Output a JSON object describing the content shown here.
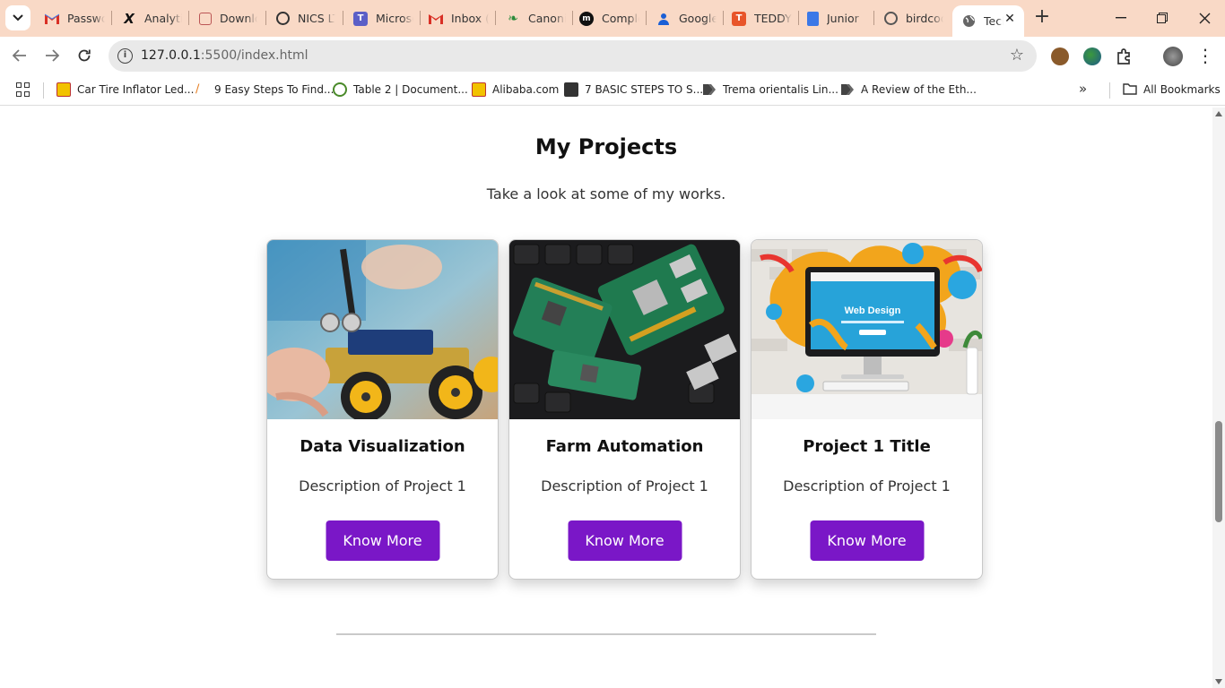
{
  "browser": {
    "tabs": [
      {
        "title": "Password",
        "icon": "gmail-icon"
      },
      {
        "title": "Analytics",
        "icon": "x-icon"
      },
      {
        "title": "Download",
        "icon": "download-icon"
      },
      {
        "title": "NICS LTD",
        "icon": "nics-icon"
      },
      {
        "title": "Microsoft",
        "icon": "teams-icon"
      },
      {
        "title": "Inbox (",
        "icon": "gmail-icon"
      },
      {
        "title": "Canonical",
        "icon": "canonical-icon"
      },
      {
        "title": "Complete",
        "icon": "medium-icon"
      },
      {
        "title": "Google",
        "icon": "google-account-icon"
      },
      {
        "title": "TEDDY",
        "icon": "teddy-icon"
      },
      {
        "title": "Junior",
        "icon": "docs-icon"
      },
      {
        "title": "birdcode",
        "icon": "github-icon"
      },
      {
        "title": "Tech",
        "icon": "globe-icon",
        "active": true
      }
    ],
    "address_bar": {
      "host": "127.0.0.1",
      "path": ":5500/index.html"
    },
    "bookmarks": [
      {
        "label": "Car Tire Inflator Led..."
      },
      {
        "label": "9 Easy Steps To Find..."
      },
      {
        "label": "Table 2 | Document..."
      },
      {
        "label": "Alibaba.com"
      },
      {
        "label": "7 BASIC STEPS TO S..."
      },
      {
        "label": "Trema orientalis Lin..."
      },
      {
        "label": "A Review of the Eth..."
      }
    ],
    "all_bookmarks_label": "All Bookmarks",
    "colors": {
      "tab_strip": "#f9d9c6",
      "accent_button": "#7a17c7"
    }
  },
  "section": {
    "title": "My Projects",
    "subtitle": "Take a look at some of my works."
  },
  "projects": [
    {
      "title": "Data Visualization",
      "description": "Description of Project 1",
      "button": "Know More",
      "image": "robot-car-image"
    },
    {
      "title": "Farm Automation",
      "description": "Description of Project 1",
      "button": "Know More",
      "image": "raspberry-pi-boards-image"
    },
    {
      "title": "Project 1 Title",
      "description": "Description of Project 1",
      "button": "Know More",
      "image": "web-design-monitor-image",
      "image_caption": "Web Design"
    }
  ]
}
